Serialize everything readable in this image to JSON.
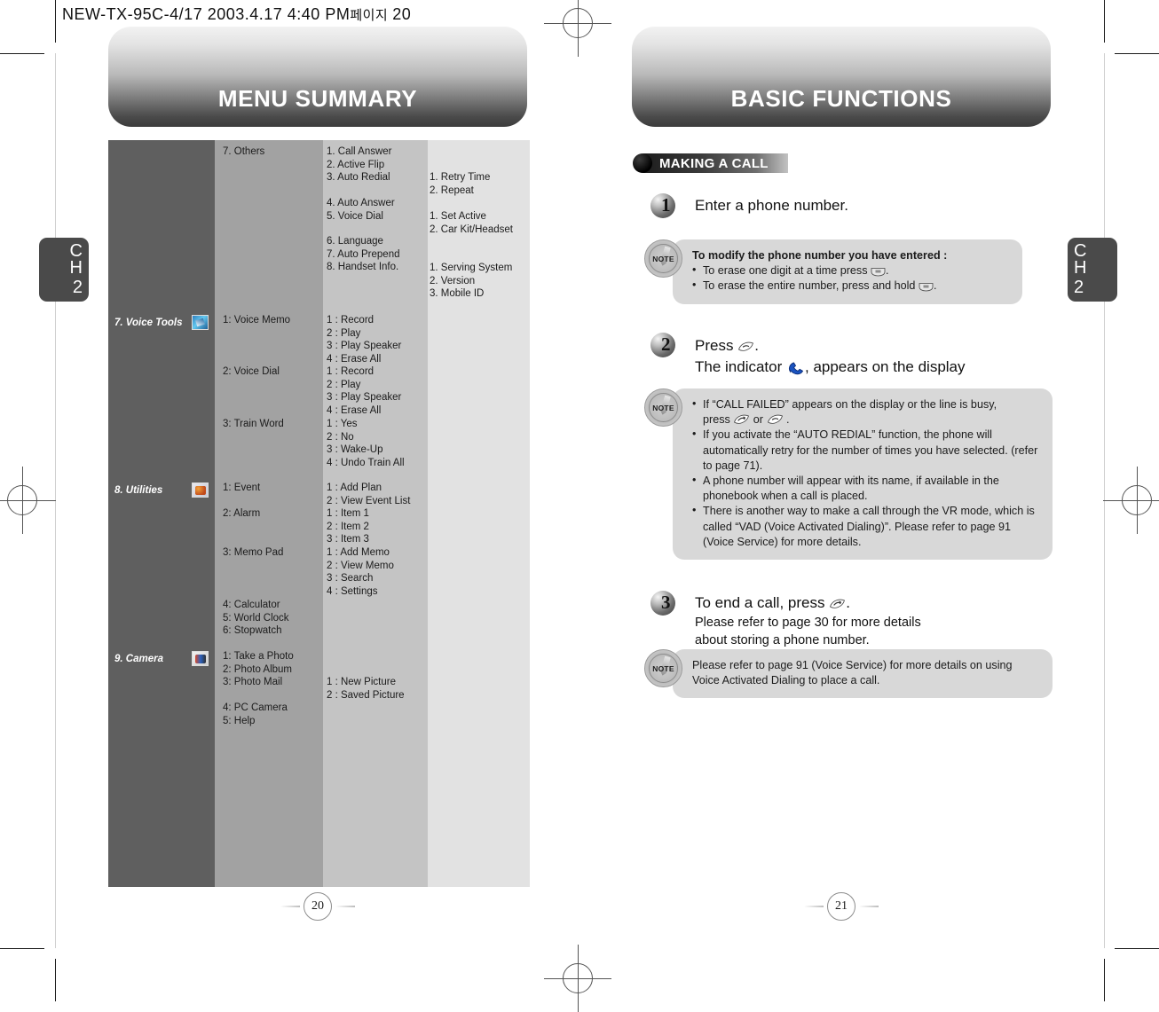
{
  "printbar": {
    "filename": "NEW-TX-95C-4/17  2003.4.17 4:40 PM",
    "korean": "페이지",
    "page": "20"
  },
  "left_page": {
    "banner_title": "MENU SUMMARY",
    "chapter_tab": {
      "lines": "C\nH",
      "number": "2"
    },
    "page_number": "20",
    "table": {
      "rows": [
        {
          "category": "",
          "icon": "",
          "col_b": "7. Others",
          "col_c": "1. Call Answer\n2. Active Flip\n3. Auto Redial",
          "col_c2": "4. Auto Answer\n5. Voice Dial",
          "col_c3": "6. Language\n7. Auto Prepend\n8. Handset Info.",
          "col_d": "1. Retry Time\n2. Repeat",
          "col_d2": "1. Set Active\n2. Car Kit/Headset",
          "col_d3": "1. Serving System\n2. Version\n3. Mobile ID"
        },
        {
          "category": "7. Voice Tools",
          "icon": "voice-tools-icon",
          "sub1": "1: Voice Memo",
          "sub2": "2: Voice Dial",
          "sub3": "3: Train Word",
          "det1": "1 : Record\n2 : Play\n3 : Play Speaker\n4 : Erase All",
          "det2": "1 : Record\n2 : Play\n3 : Play Speaker\n4 : Erase All",
          "det3": "1 : Yes\n2 : No\n3 : Wake-Up\n4 : Undo Train All"
        },
        {
          "category": "8. Utilities",
          "icon": "utilities-icon",
          "sub1": "1: Event",
          "sub2": "2: Alarm",
          "sub3": "3: Memo Pad",
          "sub4": "4: Calculator\n5: World Clock\n6: Stopwatch",
          "det1": "1 : Add Plan\n2 : View Event List",
          "det2": "1 : Item 1\n2 : Item 2\n3 : Item 3",
          "det3": "1 : Add Memo\n2 : View Memo\n3 : Search\n4 : Settings"
        },
        {
          "category": "9. Camera",
          "icon": "camera-icon",
          "sub1": "1: Take a Photo\n2: Photo Album\n3: Photo Mail",
          "sub2": "4: PC Camera\n5: Help",
          "det1": "1 : New Picture\n2 : Saved Picture"
        }
      ]
    }
  },
  "right_page": {
    "banner_title": "BASIC FUNCTIONS",
    "chapter_tab": {
      "lines": "C\nH",
      "number": "2"
    },
    "page_number": "21",
    "section_title": "MAKING A CALL",
    "steps": [
      {
        "num": "1",
        "text": "Enter a phone number.",
        "sub": ""
      },
      {
        "num": "2",
        "text": "Press ",
        "text_line1_after": ".",
        "text_line2_pre": "The indicator ",
        "text_line2_post": ", appears on the display"
      },
      {
        "num": "3",
        "text": "To end a call, press ",
        "text_after": ".",
        "sub": "Please refer to page 30 for more details\nabout storing a phone number."
      }
    ],
    "notes": [
      {
        "label": "NOTE",
        "heading": "To modify the phone number you have entered :",
        "bullets_pre": [
          "To erase one digit at a time press ",
          "To erase the entire number, press and hold "
        ],
        "bullets_post": [
          ".",
          "."
        ]
      },
      {
        "label": "NOTE",
        "bullet1_a": "If “CALL FAILED” appears on the display or the line is busy,",
        "bullet1_b": "press ",
        "bullet1_c": " or ",
        "bullet1_d": " .",
        "bullet2": "If you activate the “AUTO REDIAL” function, the phone will automatically retry for the number of times you have selected. (refer to page 71).",
        "bullet3": "A phone number will appear with its name, if available in the phonebook when a call is placed.",
        "bullet4": "There is another way to make a call through the VR mode, which is called “VAD (Voice Activated Dialing)”. Please refer to page 91 (Voice Service) for more details."
      },
      {
        "label": "NOTE",
        "text": "Please refer to page 91 (Voice Service) for more details on using Voice Activated Dialing to place a call."
      }
    ]
  },
  "colors": {
    "col_a": "#5f5f5f",
    "col_b": "#a2a2a2",
    "col_c": "#c4c4c4",
    "col_d": "#e2e2e2",
    "note_bg": "#d8d8d8",
    "tab_bg": "#4a4a4a"
  }
}
